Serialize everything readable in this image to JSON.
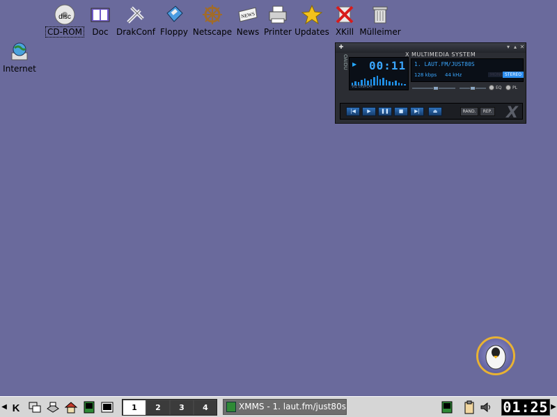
{
  "desktop": {
    "icons": [
      {
        "label": "CD-ROM",
        "icon": "cdrom-disc-icon"
      },
      {
        "label": "Doc",
        "icon": "book-icon"
      },
      {
        "label": "DrakConf",
        "icon": "tools-icon"
      },
      {
        "label": "Floppy",
        "icon": "floppy-disk-icon"
      },
      {
        "label": "Netscape",
        "icon": "ship-wheel-icon"
      },
      {
        "label": "News",
        "icon": "newspaper-icon"
      },
      {
        "label": "Printer",
        "icon": "printer-icon"
      },
      {
        "label": "Updates",
        "icon": "star-update-icon"
      },
      {
        "label": "XKill",
        "icon": "xkill-icon"
      },
      {
        "label": "Mülleimer",
        "icon": "trash-icon"
      },
      {
        "label": "Internet",
        "icon": "internet-globe-icon"
      }
    ]
  },
  "xmms": {
    "title": "X MULTIMEDIA SYSTEM",
    "sidebar": "OAIDU",
    "time": "00:11",
    "viz_label": "VIZ DISPLAY",
    "song": "1. LAUT.FM/JUST80S",
    "kbps": "128 kbps",
    "khz": "44 kHz",
    "mono": "MONO",
    "stereo": "STEREO",
    "eq_label": "EQ",
    "pl_label": "PL",
    "rand_label": "RAND.",
    "rep_label": "REP.",
    "logo": "X",
    "spectrum": [
      4,
      6,
      5,
      8,
      10,
      7,
      9,
      12,
      14,
      9,
      11,
      8,
      6,
      5,
      7,
      4,
      3,
      2
    ]
  },
  "taskbar": {
    "pages": [
      "1",
      "2",
      "3",
      "4"
    ],
    "active_page": "1",
    "task_title": "XMMS - 1. laut.fm/just80s",
    "clock": "01:25"
  }
}
